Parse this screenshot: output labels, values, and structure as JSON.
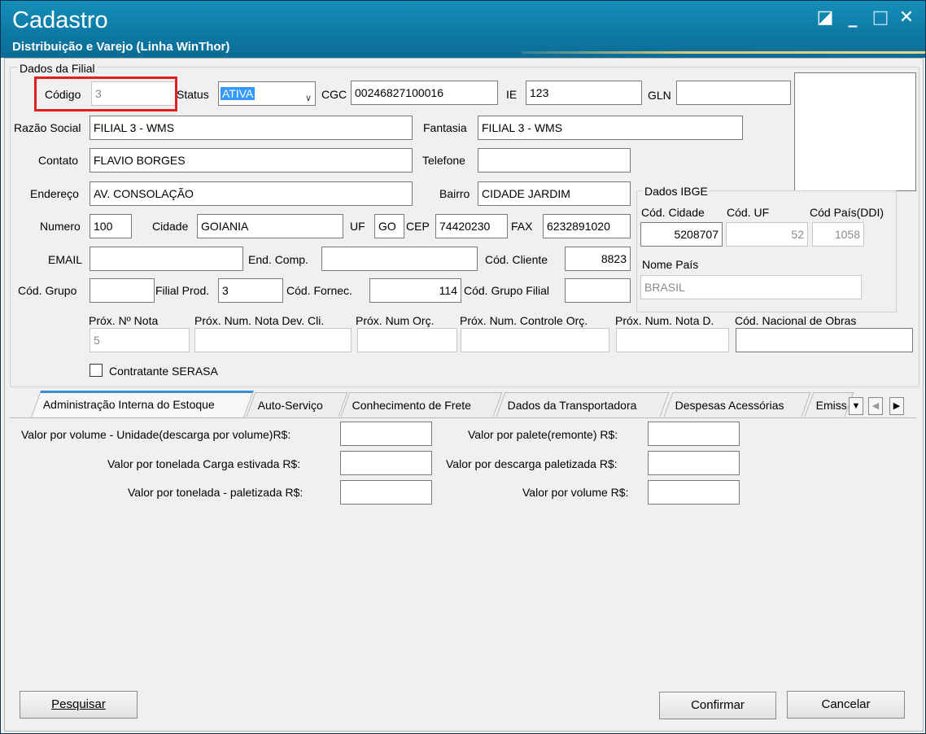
{
  "window": {
    "title": "Cadastro",
    "subtitle": "Distribuição e Varejo (Linha WinThor)",
    "controls": {
      "restore_icon": "◪",
      "minimize": "_",
      "maximize": "□",
      "close": "✕"
    }
  },
  "dados_filial": {
    "group_title": "Dados da Filial",
    "codigo": {
      "label": "Código",
      "value": "3"
    },
    "status": {
      "label": "Status",
      "value": "ATIVA"
    },
    "cgc": {
      "label": "CGC",
      "value": "00246827100016"
    },
    "ie": {
      "label": "IE",
      "value": "123"
    },
    "gln": {
      "label": "GLN",
      "value": ""
    },
    "razao_social": {
      "label": "Razão Social",
      "value": "FILIAL 3 - WMS"
    },
    "fantasia": {
      "label": "Fantasia",
      "value": "FILIAL 3 - WMS"
    },
    "contato": {
      "label": "Contato",
      "value": "FLAVIO BORGES"
    },
    "telefone": {
      "label": "Telefone",
      "value": ""
    },
    "endereco": {
      "label": "Endereço",
      "value": "AV. CONSOLAÇÃO"
    },
    "bairro": {
      "label": "Bairro",
      "value": "CIDADE JARDIM"
    },
    "numero": {
      "label": "Numero",
      "value": "100"
    },
    "cidade": {
      "label": "Cidade",
      "value": "GOIANIA"
    },
    "uf": {
      "label": "UF",
      "value": "GO"
    },
    "cep": {
      "label": "CEP",
      "value": "74420230"
    },
    "fax": {
      "label": "FAX",
      "value": "6232891020"
    },
    "email": {
      "label": "EMAIL",
      "value": ""
    },
    "end_comp": {
      "label": "End. Comp.",
      "value": ""
    },
    "cod_cliente": {
      "label": "Cód. Cliente",
      "value": "8823"
    },
    "cod_grupo": {
      "label": "Cód. Grupo",
      "value": ""
    },
    "filial_prod": {
      "label": "Filial Prod.",
      "value": "3"
    },
    "cod_fornec": {
      "label": "Cód. Fornec.",
      "value": "114"
    },
    "cod_grupo_filial": {
      "label": "Cód. Grupo Filial",
      "value": ""
    },
    "prox_nota": {
      "label": "Próx. Nº Nota",
      "value": "5"
    },
    "prox_nota_dev": {
      "label": "Próx. Num. Nota Dev. Cli.",
      "value": ""
    },
    "prox_num_orc": {
      "label": "Próx. Num Orç.",
      "value": ""
    },
    "prox_controle_orc": {
      "label": "Próx. Num. Controle Orç.",
      "value": ""
    },
    "prox_nota_d": {
      "label": "Próx. Num. Nota D.",
      "value": ""
    },
    "cod_nacional_obras": {
      "label": "Cód. Nacional de Obras",
      "value": ""
    },
    "contratante_serasa": {
      "label": "Contratante SERASA",
      "checked": false
    }
  },
  "dados_ibge": {
    "group_title": "Dados IBGE",
    "cod_cidade": {
      "label": "Cód. Cidade",
      "value": "5208707"
    },
    "cod_uf": {
      "label": "Cód. UF",
      "value": "52"
    },
    "cod_pais": {
      "label": "Cód País(DDI)",
      "value": "1058"
    },
    "nome_pais": {
      "label": "Nome País",
      "value": "BRASIL"
    }
  },
  "tabs": [
    {
      "label": "Administração Interna do Estoque"
    },
    {
      "label": "Auto-Serviço"
    },
    {
      "label": "Conhecimento de Frete"
    },
    {
      "label": "Dados da Transportadora"
    },
    {
      "label": "Despesas Acessórias"
    },
    {
      "label": "Emiss"
    }
  ],
  "tab_panel": {
    "left": [
      {
        "label": "Valor por volume - Unidade(descarga por volume)R$:",
        "value": ""
      },
      {
        "label": "Valor por tonelada Carga estivada R$:",
        "value": ""
      },
      {
        "label": "Valor por tonelada - paletizada R$:",
        "value": ""
      }
    ],
    "right": [
      {
        "label": "Valor por palete(remonte) R$:",
        "value": ""
      },
      {
        "label": "Valor por descarga paletizada R$:",
        "value": ""
      },
      {
        "label": "Valor por volume R$:",
        "value": ""
      }
    ]
  },
  "buttons": {
    "pesquisar": "Pesquisar",
    "confirmar": "Confirmar",
    "cancelar": "Cancelar"
  },
  "colors": {
    "title_bar": "#0d7aa6",
    "highlight": "#e02020",
    "selection": "#3399ff",
    "active_tab": "#3b8fd8"
  }
}
